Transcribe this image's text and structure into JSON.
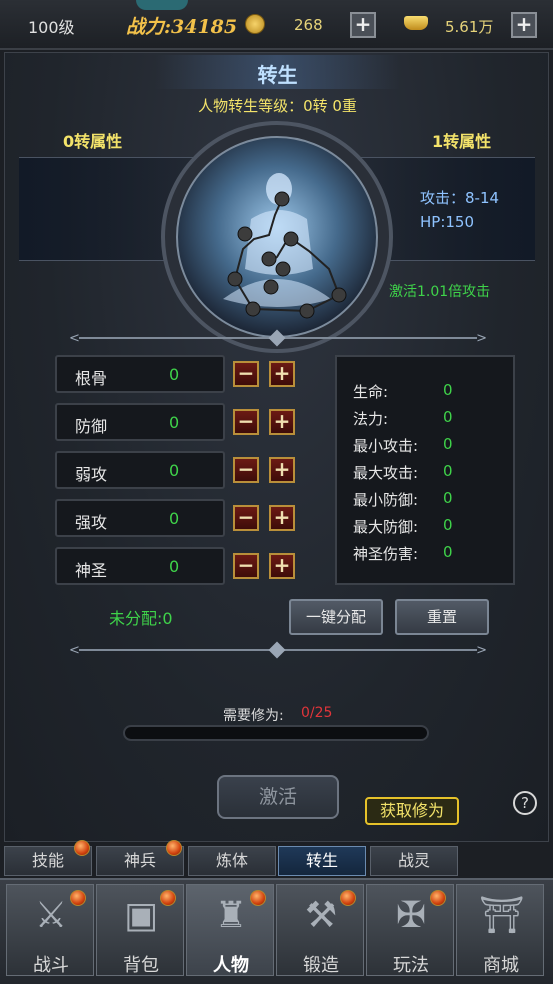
{
  "topbar": {
    "level": "100级",
    "power_label": "战力:",
    "power_value": "34185",
    "coin_icon": "coin-icon",
    "coins": "268",
    "ingot_icon": "gold-ingot-icon",
    "ingots": "5.61万",
    "plus": "+"
  },
  "panel": {
    "title": "转生",
    "rebirth_level": "人物转生等级：0转 0重",
    "left_attr_title": "0转属性",
    "right_attr_title": "1转属性",
    "next_attack": "攻击：8-14",
    "next_hp": "HP:150",
    "activate_bonus": "激活1.01倍攻击"
  },
  "attributes": [
    {
      "name": "根骨",
      "value": "0"
    },
    {
      "name": "防御",
      "value": "0"
    },
    {
      "name": "弱攻",
      "value": "0"
    },
    {
      "name": "强攻",
      "value": "0"
    },
    {
      "name": "神圣",
      "value": "0"
    }
  ],
  "controls": {
    "minus": "−",
    "plus": "+"
  },
  "stats": [
    {
      "label": "生命:",
      "value": "0"
    },
    {
      "label": "法力:",
      "value": "0"
    },
    {
      "label": "最小攻击:",
      "value": "0"
    },
    {
      "label": "最大攻击:",
      "value": "0"
    },
    {
      "label": "最小防御:",
      "value": "0"
    },
    {
      "label": "最大防御:",
      "value": "0"
    },
    {
      "label": "神圣伤害:",
      "value": "0"
    }
  ],
  "allocation": {
    "unallocated": "未分配:0",
    "auto_button": "一键分配",
    "reset_button": "重置"
  },
  "requirement": {
    "label": "需要修为:",
    "value": "0/25",
    "progress_fraction": 0
  },
  "actions": {
    "activate": "激活",
    "get_cultivation": "获取修为",
    "help": "?"
  },
  "subtabs": [
    {
      "label": "技能",
      "badge": true
    },
    {
      "label": "神兵",
      "badge": true
    },
    {
      "label": "炼体",
      "badge": false
    },
    {
      "label": "转生",
      "badge": false,
      "active": true
    },
    {
      "label": "战灵",
      "badge": false
    }
  ],
  "nav": [
    {
      "label": "战斗",
      "icon": "crossed-swords-icon",
      "badge": true
    },
    {
      "label": "背包",
      "icon": "backpack-icon",
      "badge": true
    },
    {
      "label": "人物",
      "icon": "helmet-icon",
      "badge": true,
      "active": true
    },
    {
      "label": "锻造",
      "icon": "anvil-icon",
      "badge": true
    },
    {
      "label": "玩法",
      "icon": "winged-sword-icon",
      "badge": true
    },
    {
      "label": "商城",
      "icon": "shop-gate-icon",
      "badge": false
    }
  ]
}
